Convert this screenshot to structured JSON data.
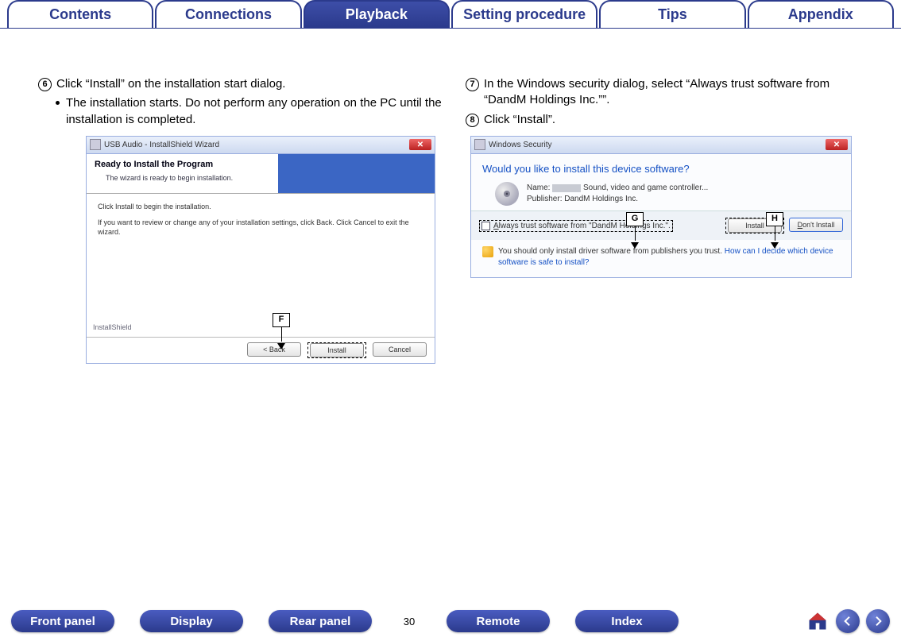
{
  "tabs": {
    "contents": "Contents",
    "connections": "Connections",
    "playback": "Playback",
    "setting": "Setting procedure",
    "tips": "Tips",
    "appendix": "Appendix"
  },
  "left": {
    "step6_num": "6",
    "step6_text": "Click “Install” on the installation start dialog.",
    "bullet": "The installation starts. Do not perform any operation on the PC until the installation is completed.",
    "dlg": {
      "title": "USB Audio - InstallShield Wizard",
      "banner_title": "Ready to Install the Program",
      "banner_sub": "The wizard is ready to begin installation.",
      "body1": "Click Install to begin the installation.",
      "body2": "If you want to review or change any of your installation settings, click Back. Click Cancel to exit the wizard.",
      "brand": "InstallShield",
      "back": "< Back",
      "install": "Install",
      "cancel": "Cancel"
    },
    "callout6": "F"
  },
  "right": {
    "step7_num": "7",
    "step7_text": "In the Windows security dialog, select “Always trust software from “DandM Holdings Inc.””.",
    "step8_num": "8",
    "step8_text": "Click “Install”.",
    "dlg": {
      "title": "Windows Security",
      "question": "Would you like to install this device software?",
      "name_label": "Name:",
      "name_value": "Sound, video and game controller...",
      "publisher_label": "Publisher:",
      "publisher_value": "DandM Holdings Inc.",
      "trust": "Always trust software from “DandM Holdings Inc.”.",
      "install": "Install",
      "dont": "Don't Install",
      "note": "You should only install driver software from publishers you trust.",
      "link": "How can I decide which device software is safe to install?"
    },
    "callout7": "G",
    "callout8": "H"
  },
  "bottom": {
    "front": "Front panel",
    "display": "Display",
    "rear": "Rear panel",
    "remote": "Remote",
    "index": "Index",
    "page": "30"
  }
}
